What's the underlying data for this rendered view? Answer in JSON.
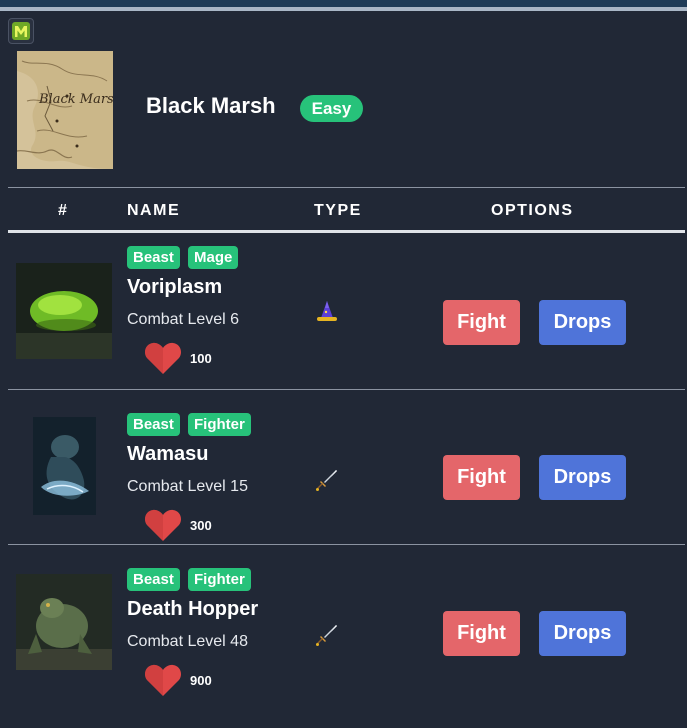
{
  "area": {
    "name": "Black Marsh",
    "difficulty": "Easy",
    "map_label": "Black Marsh",
    "colors": {
      "badge": "#27c27a"
    }
  },
  "table": {
    "headers": {
      "index": "#",
      "name": "NAME",
      "type": "TYPE",
      "options": "OPTIONS"
    }
  },
  "monsters": [
    {
      "tags": [
        "Beast",
        "Mage"
      ],
      "name": "Voriplasm",
      "combat_level": "Combat Level 6",
      "hp": "100",
      "type_icon": "wizard-hat-icon",
      "fight_label": "Fight",
      "drops_label": "Drops"
    },
    {
      "tags": [
        "Beast",
        "Fighter"
      ],
      "name": "Wamasu",
      "combat_level": "Combat Level 15",
      "hp": "300",
      "type_icon": "sword-icon",
      "fight_label": "Fight",
      "drops_label": "Drops"
    },
    {
      "tags": [
        "Beast",
        "Fighter"
      ],
      "name": "Death Hopper",
      "combat_level": "Combat Level 48",
      "hp": "900",
      "type_icon": "sword-icon",
      "fight_label": "Fight",
      "drops_label": "Drops"
    }
  ],
  "colors": {
    "fight": "#e4666a",
    "drops": "#4f74d9",
    "tag": "#27c27a",
    "panel": "#212836",
    "heart": "#e04848"
  }
}
